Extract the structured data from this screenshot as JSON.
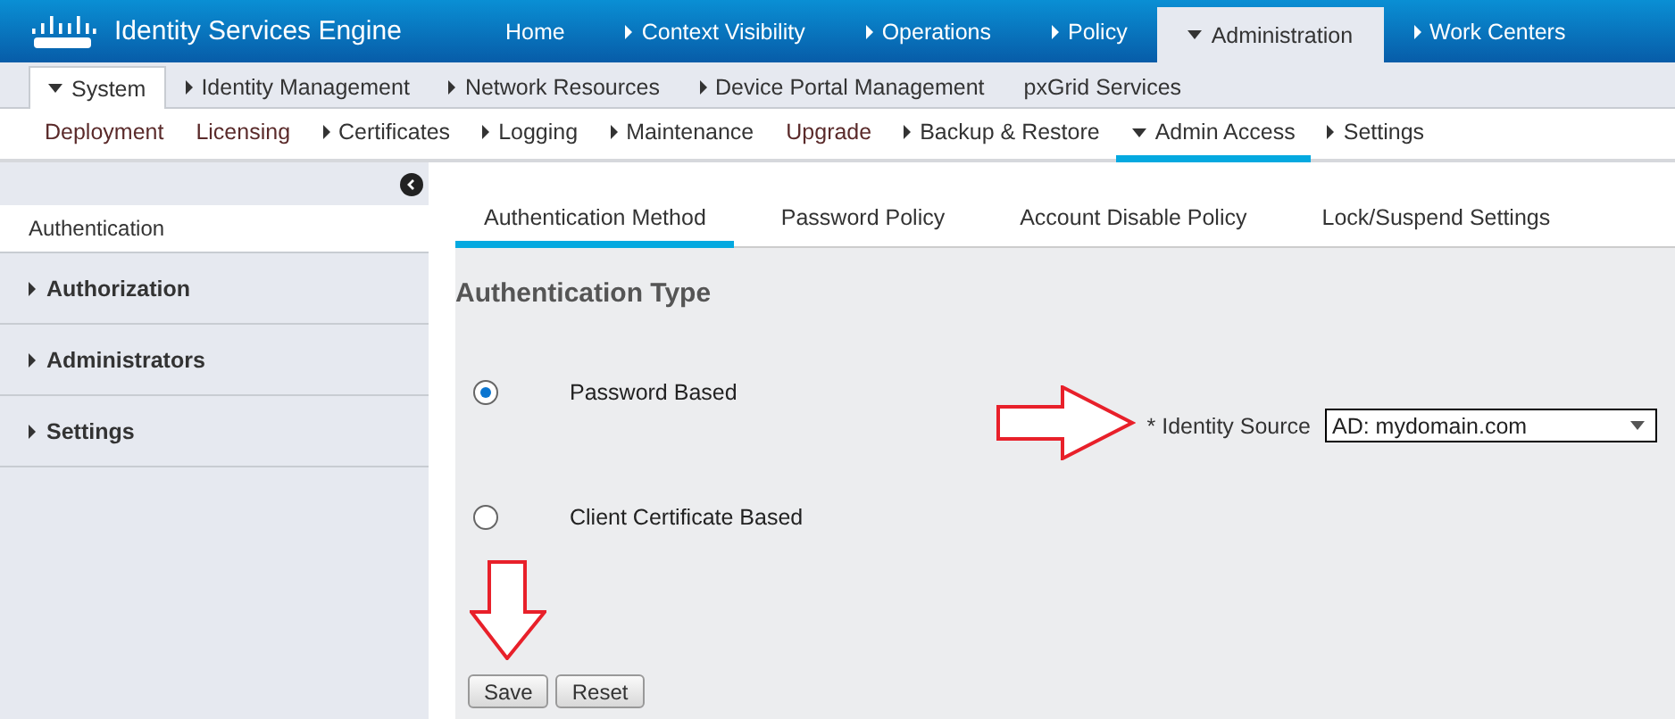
{
  "header": {
    "product": "Identity Services Engine",
    "nav": [
      {
        "label": "Home",
        "kind": "plain",
        "selected": false
      },
      {
        "label": "Context Visibility",
        "kind": "collapsed",
        "selected": false
      },
      {
        "label": "Operations",
        "kind": "collapsed",
        "selected": false
      },
      {
        "label": "Policy",
        "kind": "collapsed",
        "selected": false
      },
      {
        "label": "Administration",
        "kind": "expanded",
        "selected": true
      },
      {
        "label": "Work Centers",
        "kind": "collapsed",
        "selected": false
      }
    ]
  },
  "subnav": [
    {
      "label": "System",
      "kind": "expanded",
      "selected": true
    },
    {
      "label": "Identity Management",
      "kind": "collapsed",
      "selected": false
    },
    {
      "label": "Network Resources",
      "kind": "collapsed",
      "selected": false
    },
    {
      "label": "Device Portal Management",
      "kind": "collapsed",
      "selected": false
    },
    {
      "label": "pxGrid Services",
      "kind": "plain",
      "selected": false
    }
  ],
  "menu": [
    {
      "label": "Deployment",
      "kind": "plain",
      "selected": false
    },
    {
      "label": "Licensing",
      "kind": "plain",
      "selected": false
    },
    {
      "label": "Certificates",
      "kind": "collapsed",
      "selected": false
    },
    {
      "label": "Logging",
      "kind": "collapsed",
      "selected": false
    },
    {
      "label": "Maintenance",
      "kind": "collapsed",
      "selected": false
    },
    {
      "label": "Upgrade",
      "kind": "plain",
      "selected": false
    },
    {
      "label": "Backup & Restore",
      "kind": "collapsed",
      "selected": false
    },
    {
      "label": "Admin Access",
      "kind": "expanded",
      "selected": true
    },
    {
      "label": "Settings",
      "kind": "collapsed",
      "selected": false
    }
  ],
  "sidebar": {
    "items": [
      {
        "label": "Authentication",
        "kind": "plain",
        "selected": true
      },
      {
        "label": "Authorization",
        "kind": "collapsed",
        "selected": false
      },
      {
        "label": "Administrators",
        "kind": "collapsed",
        "selected": false
      },
      {
        "label": "Settings",
        "kind": "collapsed",
        "selected": false
      }
    ]
  },
  "tabs": [
    {
      "label": "Authentication Method",
      "selected": true
    },
    {
      "label": "Password Policy",
      "selected": false
    },
    {
      "label": "Account Disable Policy",
      "selected": false
    },
    {
      "label": "Lock/Suspend Settings",
      "selected": false
    }
  ],
  "section_title": "Authentication Type",
  "options": [
    {
      "label": "Password Based",
      "selected": true
    },
    {
      "label": "Client Certificate Based",
      "selected": false
    }
  ],
  "identity_source": {
    "label": "* Identity Source",
    "value": "AD: mydomain.com"
  },
  "buttons": [
    "Save",
    "Reset"
  ]
}
